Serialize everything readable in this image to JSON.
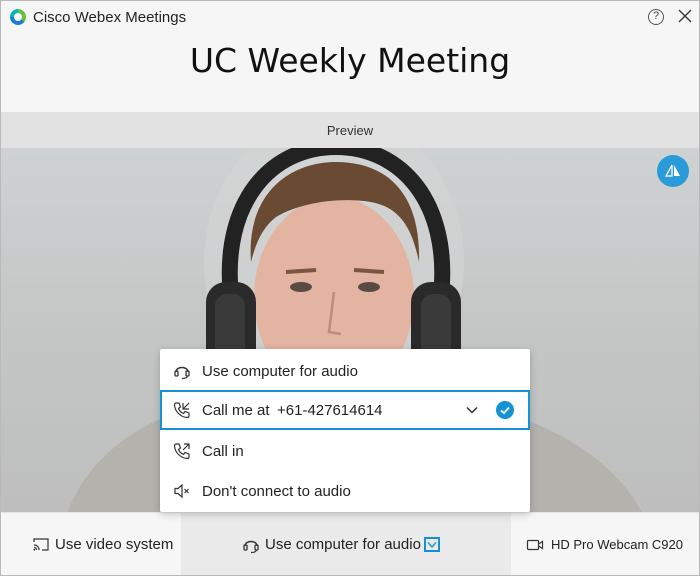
{
  "titlebar": {
    "app_title": "Cisco Webex Meetings",
    "help_label": "?",
    "help_icon": "help-icon",
    "close_icon": "close-icon"
  },
  "meeting": {
    "title": "UC Weekly Meeting"
  },
  "preview": {
    "label": "Preview",
    "mirror_icon": "mirror-view-icon"
  },
  "audio_menu": {
    "items": [
      {
        "label": "Use computer for audio",
        "icon": "headset-icon",
        "selected": false
      },
      {
        "label": "Call me at",
        "number": "+61-427614614",
        "icon": "call-me-icon",
        "selected": true
      },
      {
        "label": "Call in",
        "icon": "call-in-icon",
        "selected": false
      },
      {
        "label": "Don't connect to audio",
        "icon": "speaker-muted-icon",
        "selected": false
      }
    ]
  },
  "bottom_bar": {
    "video_system_label": "Use video system",
    "audio_label": "Use computer for audio",
    "camera_label": "HD Pro Webcam C920"
  },
  "colors": {
    "accent": "#1592d4",
    "mirror_button": "#2a9bd8"
  }
}
